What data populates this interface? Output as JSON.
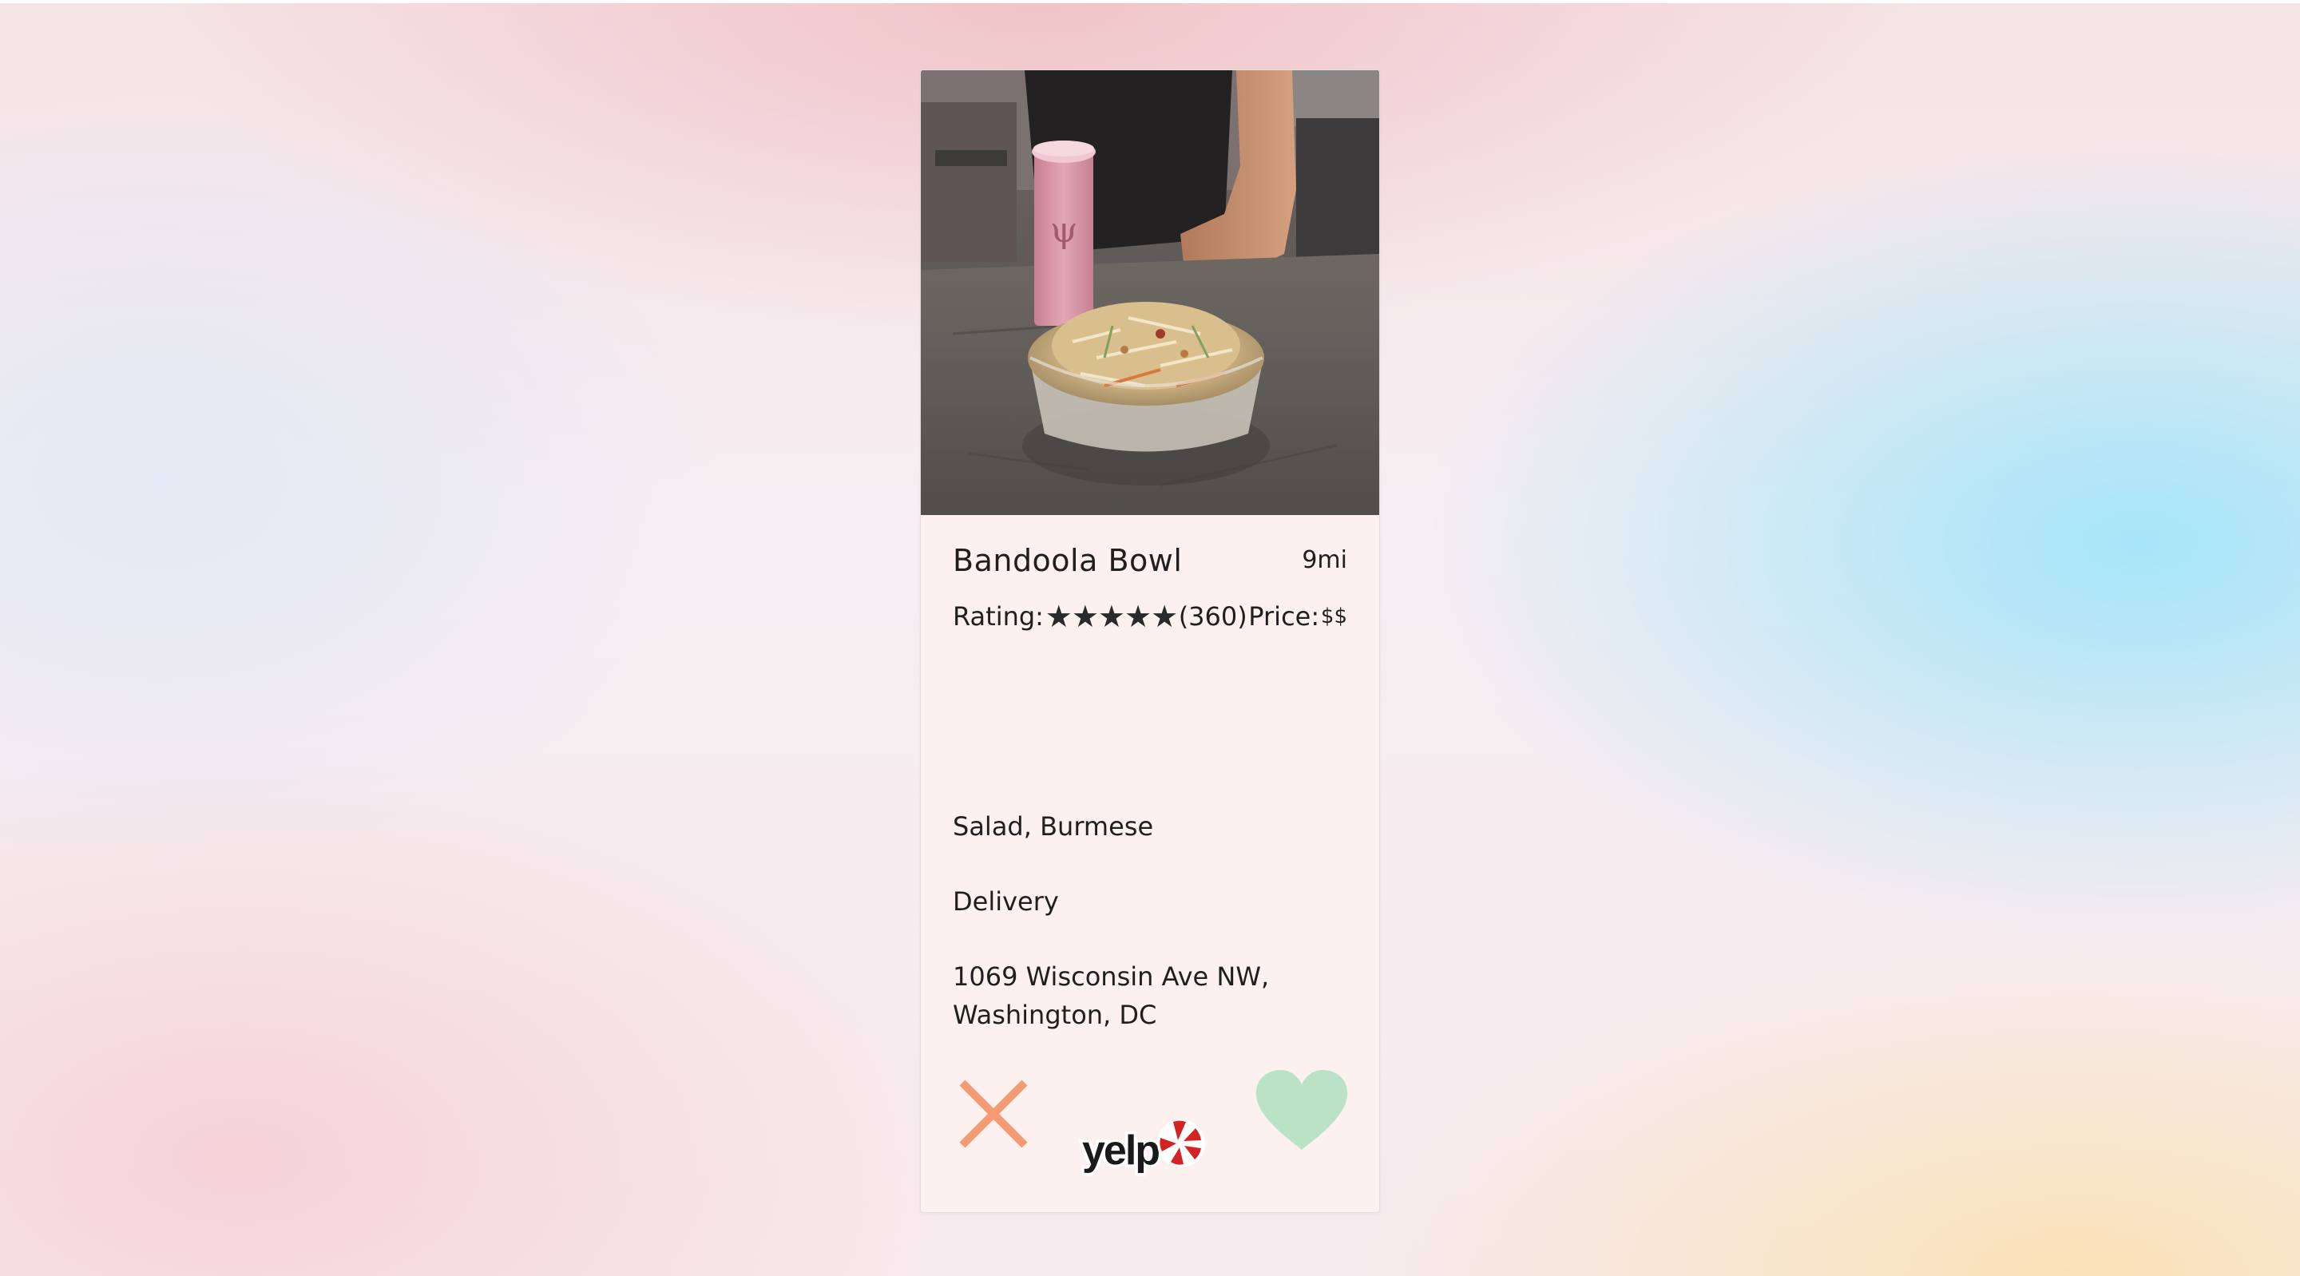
{
  "restaurant": {
    "name": "Bandoola Bowl",
    "distance": "9mi",
    "rating_label": "Rating:",
    "rating_value": 5,
    "stars": [
      "★",
      "★",
      "★",
      "★",
      "★"
    ],
    "review_count": "(360)",
    "price_label": "Price:",
    "price_value": "$$",
    "categories": "Salad, Burmese",
    "transactions": "Delivery",
    "address_line1": "1069 Wisconsin Ave NW,",
    "address_line2": "Washington, DC"
  },
  "actions": {
    "pass_icon": "x-icon",
    "like_icon": "heart-icon",
    "source_logo": "yelp-logo",
    "source_logo_text": "yelp"
  },
  "colors": {
    "card_background": "#fcf1ef",
    "pass_color": "#f59a72",
    "like_color": "#b9e2c6",
    "yelp_red": "#d32323",
    "text": "#1f1f1f"
  }
}
